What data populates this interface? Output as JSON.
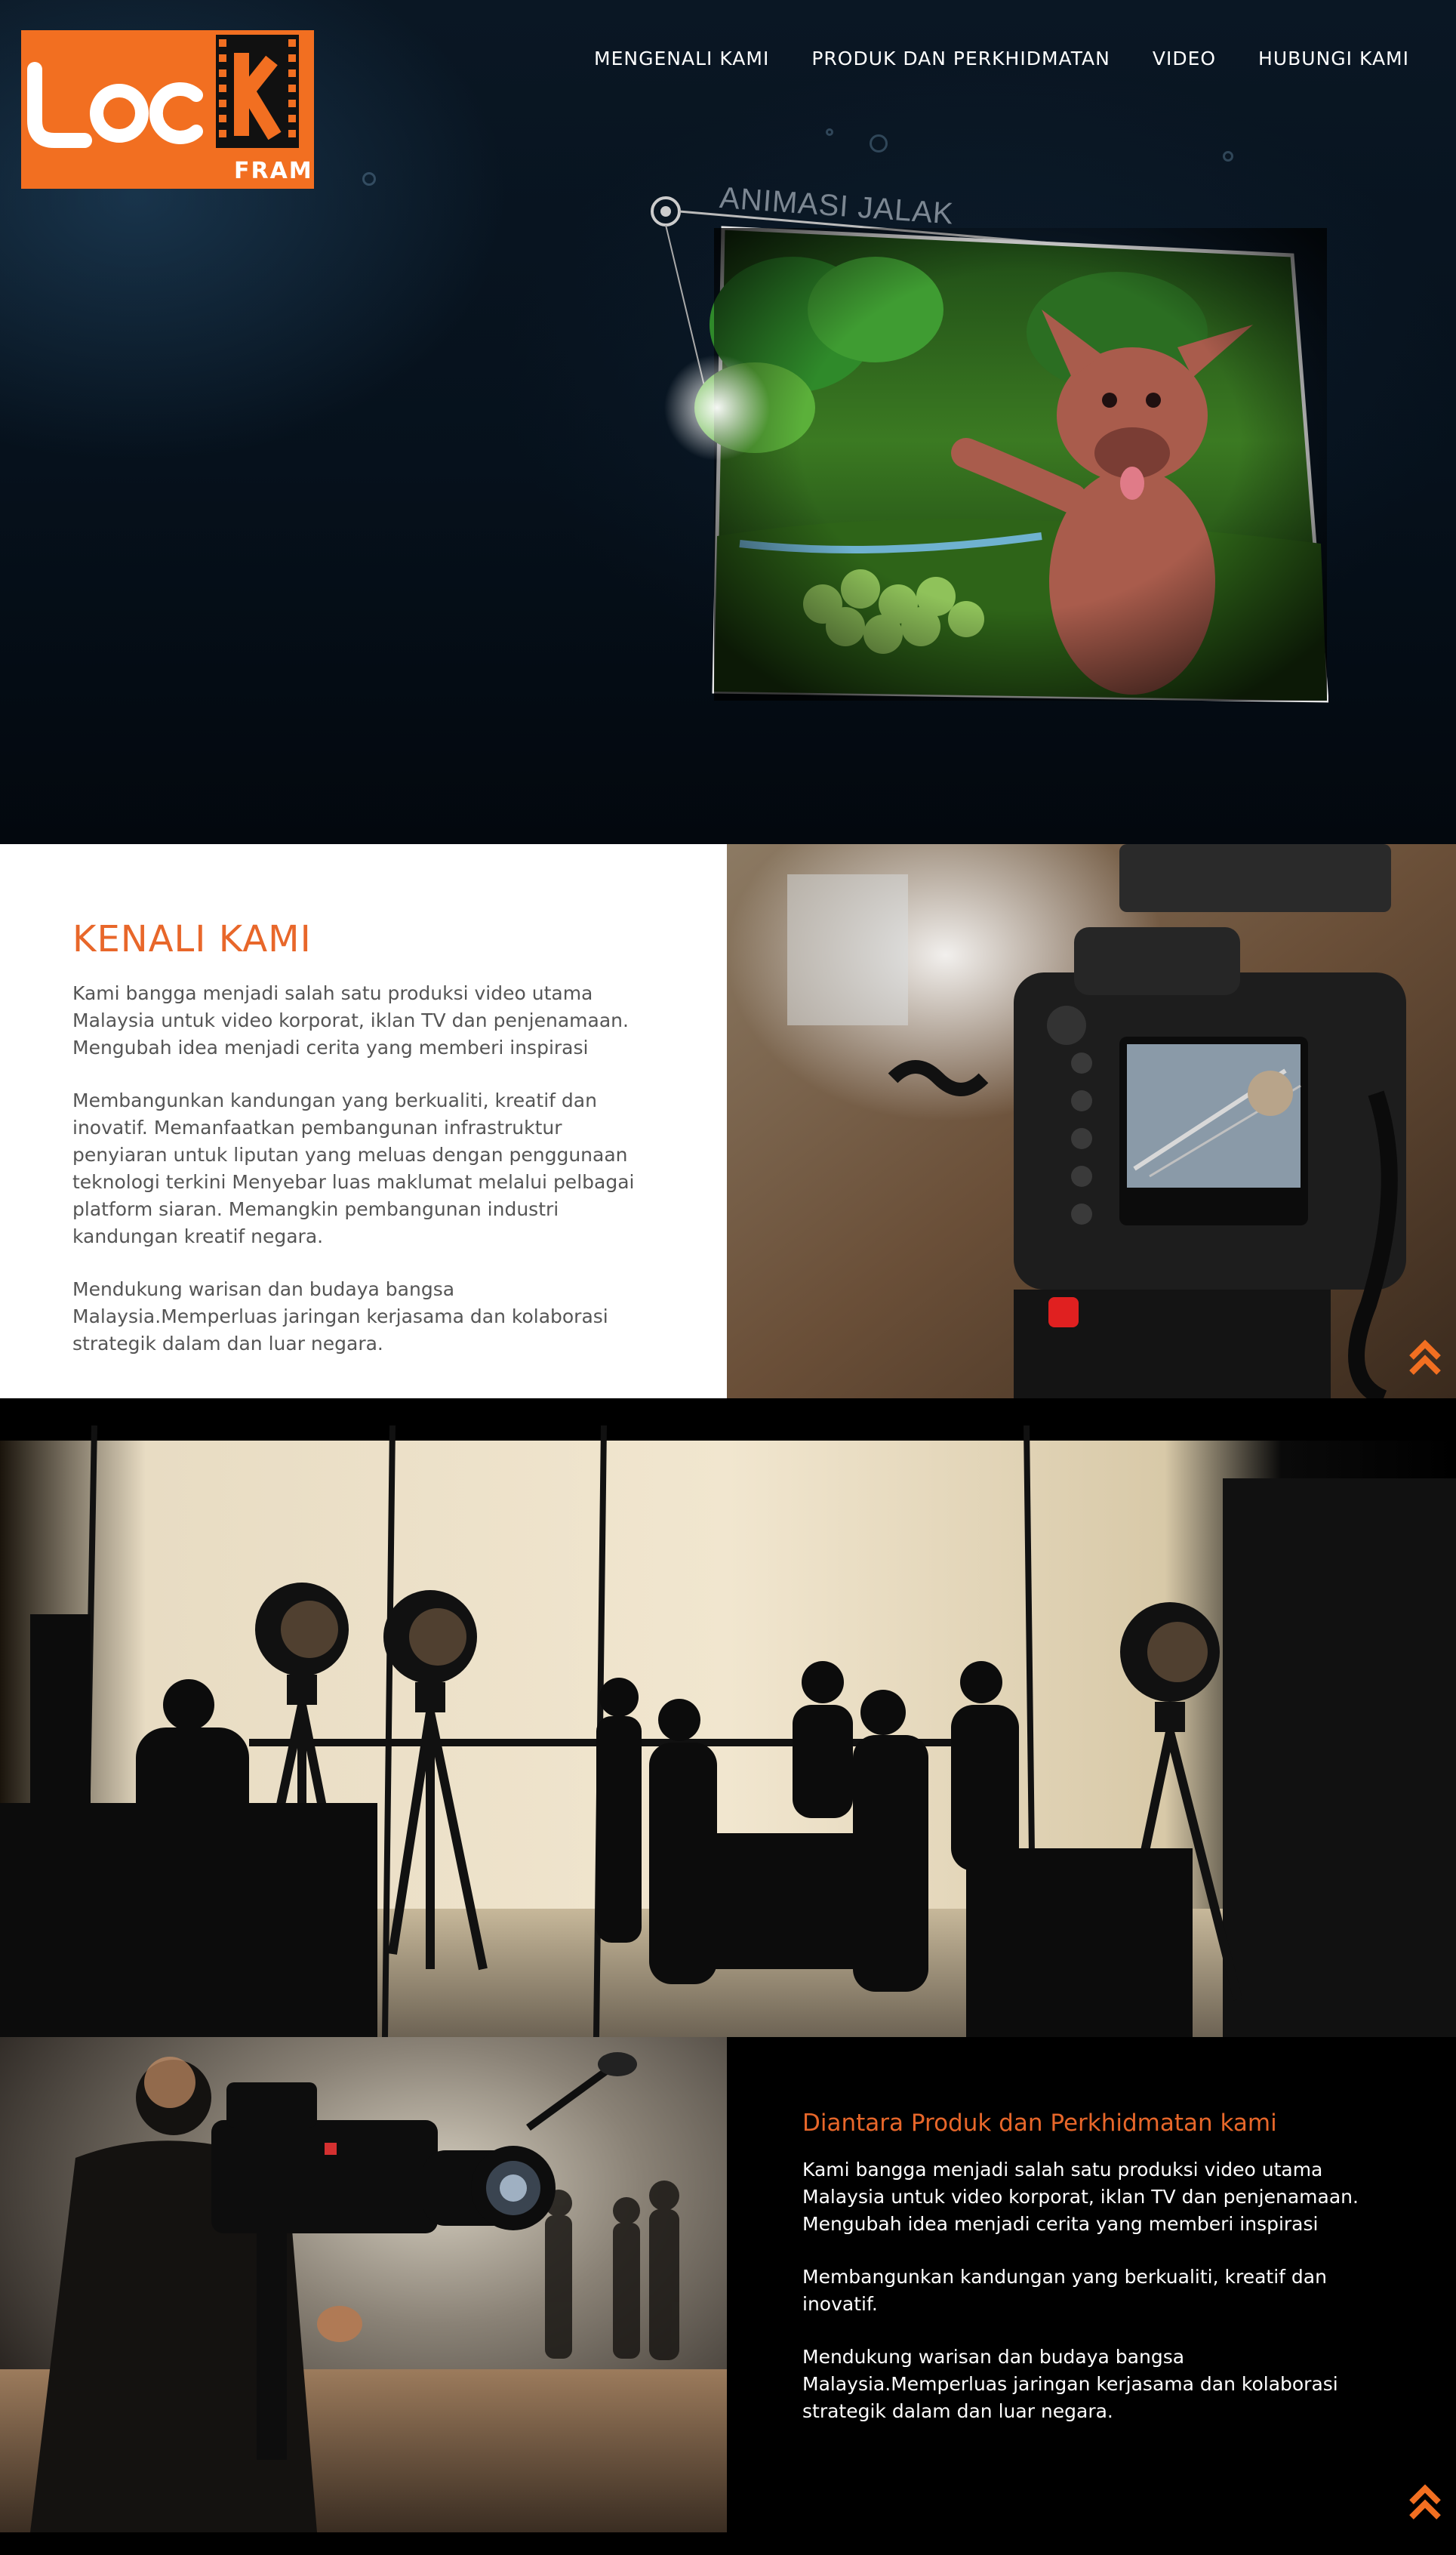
{
  "logo": {
    "text_main": "LOCK",
    "text_sub": "FRAME",
    "brand_color": "#f26f21"
  },
  "nav": {
    "items": [
      {
        "label": "MENGENALI KAMI"
      },
      {
        "label": "PRODUK DAN PERKHIDMATAN"
      },
      {
        "label": "VIDEO"
      },
      {
        "label": "HUBUNGI KAMI"
      }
    ]
  },
  "hero": {
    "screen_label": "ANIMASI JALAK"
  },
  "about": {
    "title": "KENALI KAMI",
    "paragraphs": [
      "Kami bangga menjadi salah satu produksi video utama Malaysia untuk video korporat, iklan TV dan penjenamaan. Mengubah idea menjadi cerita yang memberi inspirasi",
      "Membangunkan kandungan yang berkualiti, kreatif dan inovatif. Memanfaatkan pembangunan infrastruktur penyiaran untuk liputan yang meluas dengan penggunaan teknologi terkini Menyebar luas maklumat melalui pelbagai platform siaran. Memangkin pembangunan industri kandungan kreatif negara.",
      "Mendukung warisan dan budaya bangsa Malaysia.Memperluas jaringan kerjasama dan kolaborasi strategik dalam dan luar negara."
    ]
  },
  "services": {
    "title": "Diantara Produk dan Perkhidmatan kami",
    "paragraphs": [
      "Kami bangga menjadi salah satu produksi video utama Malaysia untuk video korporat, iklan TV dan penjenamaan. Mengubah idea menjadi cerita yang memberi inspirasi",
      "Membangunkan kandungan yang berkualiti, kreatif dan inovatif.",
      "Mendukung warisan dan budaya bangsa Malaysia.Memperluas jaringan kerjasama dan kolaborasi strategik dalam dan luar negara."
    ]
  },
  "colors": {
    "accent": "#e8672a",
    "hero_bg": "#06111c"
  },
  "icons": {
    "scroll_top": "double-chevron-up-icon"
  }
}
